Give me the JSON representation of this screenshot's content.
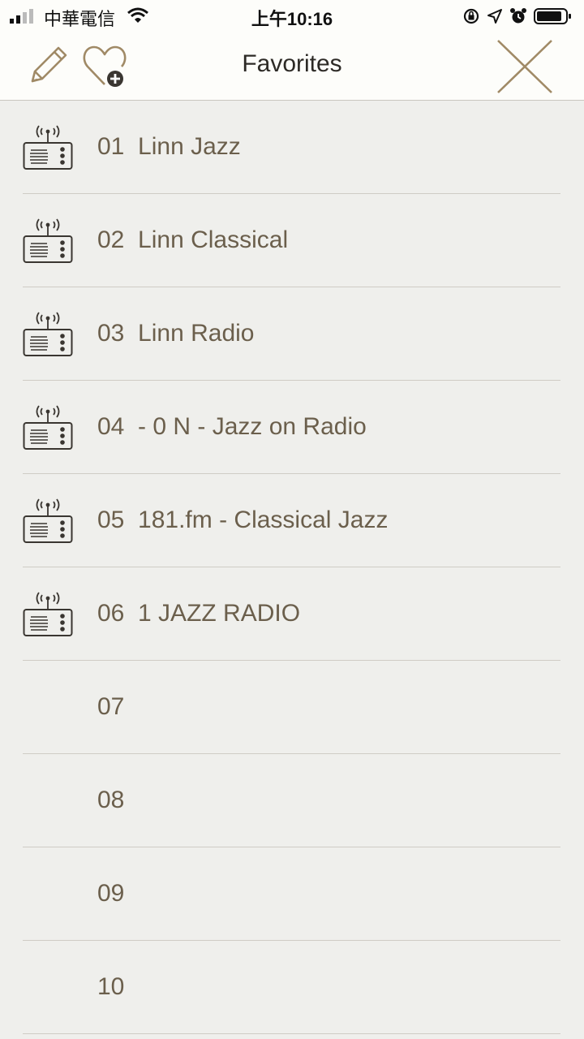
{
  "status_bar": {
    "carrier": "中華電信",
    "time": "上午10:16"
  },
  "nav": {
    "title": "Favorites",
    "edit_icon": "pencil-icon",
    "add_favorite_icon": "heart-plus-icon",
    "close_icon": "close-icon"
  },
  "favorites": [
    {
      "label": "01  Linn Jazz",
      "icon": "radio-icon"
    },
    {
      "label": "02  Linn Classical",
      "icon": "radio-icon"
    },
    {
      "label": "03  Linn Radio",
      "icon": "radio-icon"
    },
    {
      "label": "04  - 0 N - Jazz on Radio",
      "icon": "radio-icon"
    },
    {
      "label": "05  181.fm - Classical Jazz",
      "icon": "radio-icon"
    },
    {
      "label": "06  1 JAZZ RADIO",
      "icon": "radio-icon"
    },
    {
      "label": "07",
      "icon": ""
    },
    {
      "label": "08",
      "icon": ""
    },
    {
      "label": "09",
      "icon": ""
    },
    {
      "label": "10",
      "icon": ""
    }
  ],
  "colors": {
    "accent": "#9b8663",
    "text": "#6b5f4c",
    "background": "#efefec"
  }
}
